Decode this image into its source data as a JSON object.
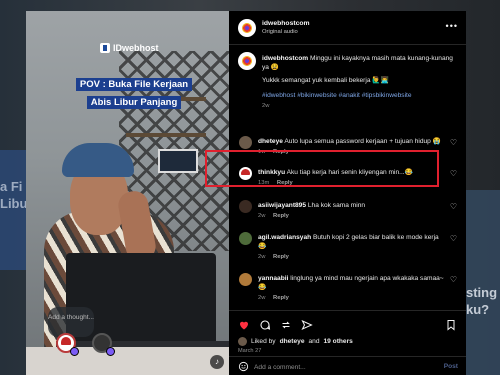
{
  "media": {
    "brand_text": "IDwebhost",
    "caption_line1": "POV : Buka File Kerjaan",
    "caption_line2": "Abis Libur Panjang",
    "thought_placeholder": "Add a thought..."
  },
  "header": {
    "username": "idwebhostcom",
    "subtitle": "Original audio"
  },
  "post_caption": {
    "username": "idwebhostcom",
    "text": "Minggu ini kayaknya masih mata kunang-kunang ya 😫",
    "line2": "Yukkk semangat yuk kembali bekerja 🙋‍♂️👨‍💻",
    "hashtags": "#idwebhost #bikinwebsite #anakit #tipsbikinwebsite",
    "time": "2w"
  },
  "comments": [
    {
      "username": "dheteye",
      "text": "Auto lupa semua password kerjaan + tujuan hidup 😭",
      "time": "1w",
      "reply": "Reply",
      "avatar_color": "#6b5a4a"
    },
    {
      "username": "thinkkyu",
      "text": "Aku tiap kerja hari senin kliyengan min...😂",
      "time": "13m",
      "reply": "Reply",
      "avatar_color": "#c62828"
    },
    {
      "username": "asiiwijayant895",
      "text": "Lha kok sama minn",
      "time": "2w",
      "reply": "Reply",
      "avatar_color": "#3a2a22"
    },
    {
      "username": "agil.wadriansyah",
      "text": "Butuh kopi 2 gelas biar balik ke mode kerja 😂",
      "time": "2w",
      "reply": "Reply",
      "avatar_color": "#4e6b3a"
    },
    {
      "username": "yannaabii",
      "text": "linglung ya mind mau ngerjain apa wkakaka samaa~ 😂",
      "time": "2w",
      "reply": "Reply",
      "avatar_color": "#b07a3a"
    }
  ],
  "likes": {
    "prefix": "Liked by",
    "user": "dheteye",
    "middle": "and",
    "others": "19 others"
  },
  "date": "March 27",
  "composer": {
    "placeholder": "Add a comment...",
    "post_label": "Post"
  },
  "colors": {
    "highlight_border": "#e0202e",
    "like_red": "#ff3040",
    "hashtag_blue": "#7ea6e6",
    "caption_bg": "#1c3f8f"
  }
}
